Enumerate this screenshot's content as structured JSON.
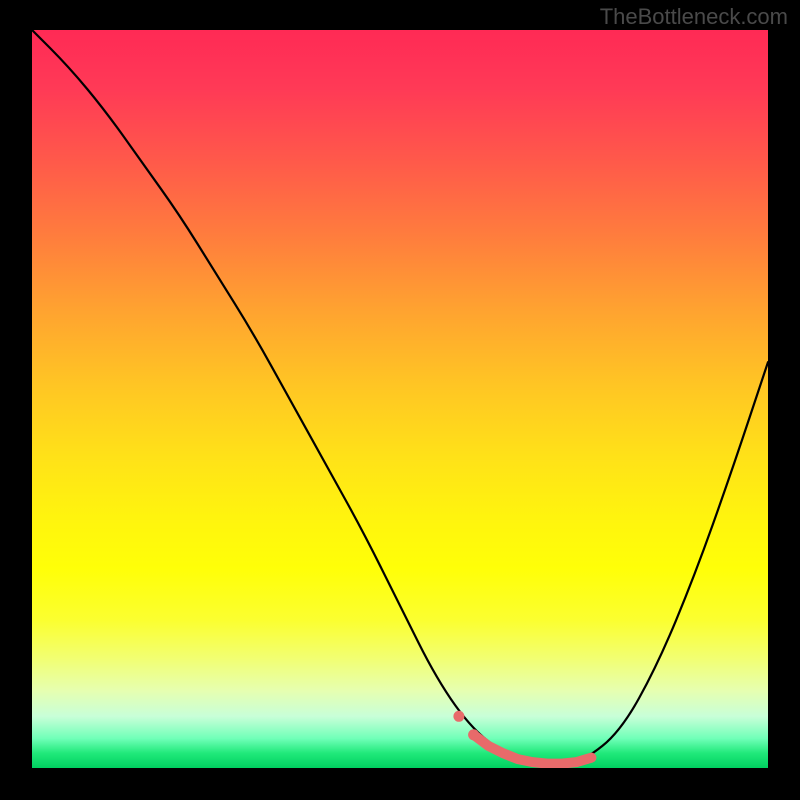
{
  "watermark": "TheBottleneck.com",
  "chart_data": {
    "type": "line",
    "title": "",
    "xlabel": "",
    "ylabel": "",
    "xlim": [
      0,
      100
    ],
    "ylim": [
      0,
      100
    ],
    "curve": {
      "x": [
        0,
        5,
        10,
        15,
        20,
        25,
        30,
        35,
        40,
        45,
        50,
        55,
        60,
        65,
        70,
        72,
        75,
        80,
        85,
        90,
        95,
        100
      ],
      "y": [
        100,
        95,
        89,
        82,
        75,
        67,
        59,
        50,
        41,
        32,
        22,
        12,
        5,
        1.5,
        0.6,
        0.6,
        1.0,
        5,
        14,
        26,
        40,
        55
      ]
    },
    "highlight_segment": {
      "x": [
        60,
        62,
        64,
        66,
        68,
        70,
        72,
        74,
        76
      ],
      "y": [
        4.5,
        3.0,
        2.0,
        1.2,
        0.8,
        0.6,
        0.6,
        0.8,
        1.4
      ]
    },
    "highlight_dots": [
      {
        "x": 58,
        "y": 7.0
      },
      {
        "x": 60,
        "y": 4.5
      }
    ],
    "colors": {
      "gradient_top": "#ff2a55",
      "gradient_mid": "#ffe218",
      "gradient_bottom": "#00d060",
      "curve": "#000000",
      "highlight": "#e86a6a",
      "background": "#000000"
    }
  }
}
